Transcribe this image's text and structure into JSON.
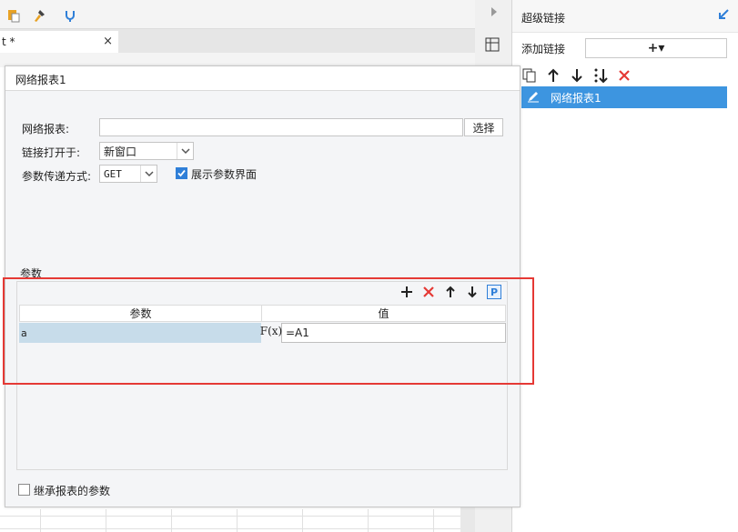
{
  "editor": {
    "doc_tab": "t *",
    "doc_tab_close": "×"
  },
  "right_panel": {
    "title": "超级链接",
    "add_label": "添加链接",
    "add_button": "+▾",
    "toolbar": [
      "copy-icon",
      "move-up-icon",
      "move-down-icon",
      "sort-icon",
      "delete-icon"
    ],
    "items": [
      {
        "label": "网络报表1",
        "icon": "pencil-icon",
        "selected": true
      }
    ],
    "selection_color": "#3d95e0"
  },
  "dialog": {
    "title": "网络报表1",
    "report_label": "网络报表:",
    "report_value": "",
    "choose_button": "选择",
    "open_in_label": "链接打开于:",
    "open_in_value": "新窗口",
    "method_label": "参数传递方式:",
    "method_value": "GET",
    "show_params_label": "展示参数界面",
    "show_params_checked": true,
    "params_label": "参数",
    "params_tools": [
      "add-icon",
      "delete-icon",
      "move-up-icon",
      "move-down-icon",
      "p-icon"
    ],
    "p_badge": "P",
    "params_table": {
      "columns": [
        "参数",
        "值"
      ],
      "rows": [
        {
          "name": "a",
          "fx": "F(x)",
          "value": "=A1"
        }
      ]
    },
    "inherit_label": "继承报表的参数",
    "inherit_checked": false
  },
  "colors": {
    "highlight": "#e53935",
    "accent": "#2f7fd8",
    "delete": "#e53935"
  }
}
